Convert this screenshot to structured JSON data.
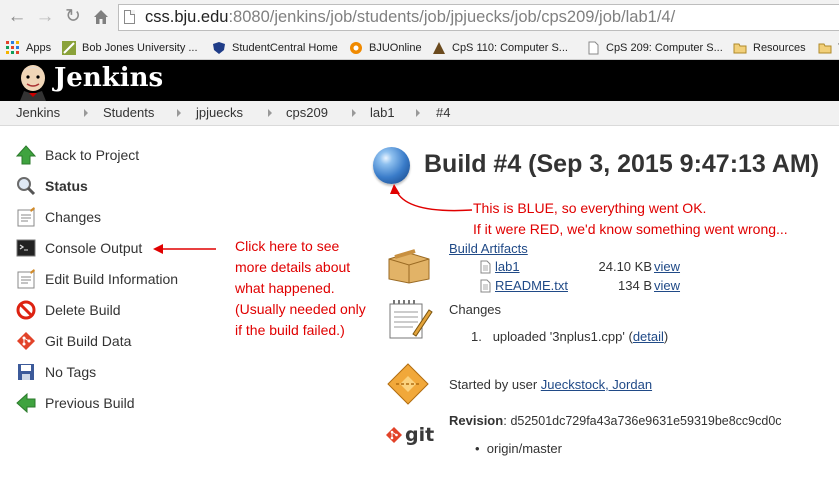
{
  "browser": {
    "url_host": "css.bju.edu",
    "url_rest": ":8080/jenkins/job/students/job/jpjuecks/job/cps209/job/lab1/4/",
    "bookmarks": [
      {
        "label": "Apps"
      },
      {
        "label": "Bob Jones University ..."
      },
      {
        "label": "StudentCentral Home"
      },
      {
        "label": "BJUOnline"
      },
      {
        "label": "CpS 110: Computer S..."
      },
      {
        "label": "CpS 209: Computer S..."
      },
      {
        "label": "Resources"
      },
      {
        "label": "T"
      }
    ]
  },
  "header": {
    "title": "Jenkins"
  },
  "breadcrumbs": [
    "Jenkins",
    "Students",
    "jpjuecks",
    "cps209",
    "lab1",
    "#4"
  ],
  "sidebar": {
    "items": [
      {
        "label": "Back to Project"
      },
      {
        "label": "Status"
      },
      {
        "label": "Changes"
      },
      {
        "label": "Console Output"
      },
      {
        "label": "Edit Build Information"
      },
      {
        "label": "Delete Build"
      },
      {
        "label": "Git Build Data"
      },
      {
        "label": "No Tags"
      },
      {
        "label": "Previous Build"
      }
    ]
  },
  "annotations": {
    "console": [
      "Click here to see",
      "more details about",
      "what happened.",
      "(Usually needed only",
      "if the build failed.)"
    ],
    "status": [
      "This is BLUE, so everything went OK.",
      "If it were RED, we'd know something went wrong..."
    ],
    "color": "#e00000"
  },
  "build": {
    "title": "Build #4 (Sep 3, 2015 9:47:13 AM)",
    "status_color": "#3a7cc9",
    "artifacts_heading": "Build Artifacts",
    "artifacts": [
      {
        "name": "lab1",
        "size": "24.10 KB",
        "action": "view"
      },
      {
        "name": "README.txt",
        "size": "134 B",
        "action": "view"
      }
    ],
    "changes_heading": "Changes",
    "change_number": "1.",
    "change_text": "uploaded '3nplus1.cpp' (",
    "change_link": "detail",
    "change_close": ")",
    "started_prefix": "Started by user ",
    "started_user": "Jueckstock, Jordan",
    "git_logo": "git",
    "revision_label": "Revision",
    "revision_colon": ":",
    "revision_value": "d52501dc729fa43a736e9631e59319be8cc9cd0c",
    "branch": "origin/master"
  }
}
